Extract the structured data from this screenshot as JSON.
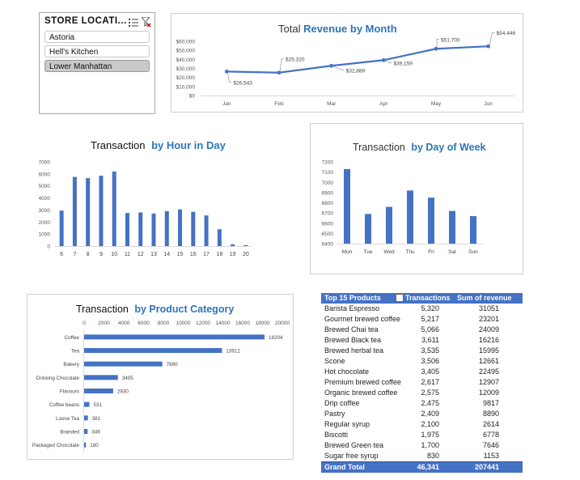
{
  "slicer": {
    "title": "STORE LOCATI...",
    "items": [
      {
        "label": "Astoria",
        "selected": false
      },
      {
        "label": "Hell's Kitchen",
        "selected": false
      },
      {
        "label": "Lower Manhattan",
        "selected": true
      }
    ]
  },
  "colors": {
    "bar": "#4472c4",
    "line": "#4472c4",
    "title_accent": "#2e75b6",
    "header": "#4472c4"
  },
  "chart_data": [
    {
      "type": "line",
      "title": "Total Revenue by Month",
      "title_parts": [
        "Total ",
        "Revenue by Month"
      ],
      "categories": [
        "Jan",
        "Feb",
        "Mar",
        "Apr",
        "May",
        "Jun"
      ],
      "values": [
        26543,
        25320,
        32889,
        39159,
        51700,
        54446
      ],
      "data_labels": [
        "$26,543",
        "$25,320",
        "$32,889",
        "$39,159",
        "$51,700",
        "$54,446"
      ],
      "y_ticks": [
        "$0",
        "$10,000",
        "$20,000",
        "$30,000",
        "$40,000",
        "$50,000",
        "$60,000"
      ],
      "ylim": [
        0,
        60000
      ],
      "grid": false
    },
    {
      "type": "bar",
      "title": "Transaction by Hour in Day",
      "title_parts": [
        "Transaction ",
        "by Hour in Day"
      ],
      "categories": [
        "6",
        "7",
        "8",
        "9",
        "10",
        "11",
        "12",
        "13",
        "14",
        "15",
        "16",
        "17",
        "18",
        "19",
        "20"
      ],
      "values": [
        2950,
        5750,
        5650,
        5850,
        6200,
        2750,
        2800,
        2700,
        2900,
        3050,
        2850,
        2550,
        1400,
        150,
        80
      ],
      "y_ticks": [
        "0",
        "1000",
        "2000",
        "3000",
        "4000",
        "5000",
        "6000",
        "7000"
      ],
      "ylim": [
        0,
        7000
      ]
    },
    {
      "type": "bar",
      "title": "Transaction by Day of Week",
      "title_parts": [
        "Transaction ",
        "by Day of Week"
      ],
      "categories": [
        "Mon",
        "Tue",
        "Wed",
        "Thu",
        "Fri",
        "Sat",
        "Sun"
      ],
      "values": [
        7130,
        6690,
        6760,
        6920,
        6850,
        6720,
        6670
      ],
      "y_ticks": [
        "6400",
        "6500",
        "6600",
        "6700",
        "6800",
        "6900",
        "7000",
        "7100",
        "7200"
      ],
      "ylim": [
        6400,
        7200
      ]
    },
    {
      "type": "bar",
      "orientation": "horizontal",
      "title": "Transaction by Product Category",
      "title_parts": [
        "Transaction ",
        "by Product Category"
      ],
      "categories": [
        "Coffee",
        "Tea",
        "Bakery",
        "Drinking Chocolate",
        "Flavours",
        "Coffee beans",
        "Loose Tea",
        "Branded",
        "Packaged Chocolate"
      ],
      "values": [
        18204,
        13912,
        7890,
        3405,
        2930,
        531,
        381,
        349,
        180
      ],
      "x_ticks": [
        "0",
        "2000",
        "4000",
        "6000",
        "8000",
        "10000",
        "12000",
        "14000",
        "16000",
        "18000",
        "20000"
      ],
      "xlim": [
        0,
        20000
      ]
    },
    {
      "type": "table",
      "columns": [
        "Top 15 Products",
        "Transactions",
        "Sum of revenue"
      ],
      "rows": [
        [
          "Barista Espresso",
          "5,320",
          "31051"
        ],
        [
          "Gourmet brewed coffee",
          "5,217",
          "23201"
        ],
        [
          "Brewed Chai tea",
          "5,066",
          "24009"
        ],
        [
          "Brewed Black tea",
          "3,611",
          "16216"
        ],
        [
          "Brewed herbal tea",
          "3,535",
          "15995"
        ],
        [
          "Scone",
          "3,506",
          "12661"
        ],
        [
          "Hot chocolate",
          "3,405",
          "22495"
        ],
        [
          "Premium brewed coffee",
          "2,617",
          "12907"
        ],
        [
          "Organic brewed coffee",
          "2,575",
          "12009"
        ],
        [
          "Drip coffee",
          "2,475",
          "9817"
        ],
        [
          "Pastry",
          "2,409",
          "8890"
        ],
        [
          "Regular syrup",
          "2,100",
          "2614"
        ],
        [
          "Biscotti",
          "1,975",
          "6778"
        ],
        [
          "Brewed Green tea",
          "1,700",
          "7646"
        ],
        [
          "Sugar free syrup",
          "830",
          "1153"
        ]
      ],
      "total": [
        "Grand Total",
        "46,341",
        "207441"
      ]
    }
  ]
}
